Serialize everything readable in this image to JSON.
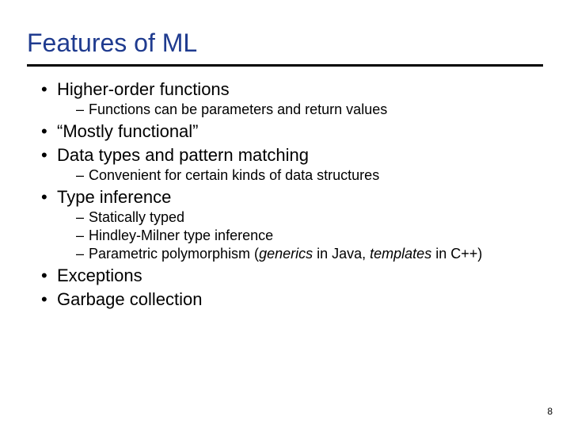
{
  "title": "Features of ML",
  "bullets": {
    "b0": {
      "text": "Higher-order functions",
      "sub": [
        "Functions can be parameters and return values"
      ]
    },
    "b1": {
      "text": "“Mostly functional”"
    },
    "b2": {
      "text": "Data types and pattern matching",
      "sub": [
        "Convenient for certain kinds of data structures"
      ]
    },
    "b3": {
      "text": "Type inference",
      "sub": [
        "Statically typed",
        "Hindley-Milner type inference"
      ],
      "sub_poly": {
        "prefix": "Parametric polymorphism (",
        "g": "generics",
        "mid": " in Java, ",
        "t": "templates",
        "suffix": " in C++)"
      }
    },
    "b4": {
      "text": "Exceptions"
    },
    "b5": {
      "text": "Garbage collection"
    }
  },
  "page_number": "8"
}
